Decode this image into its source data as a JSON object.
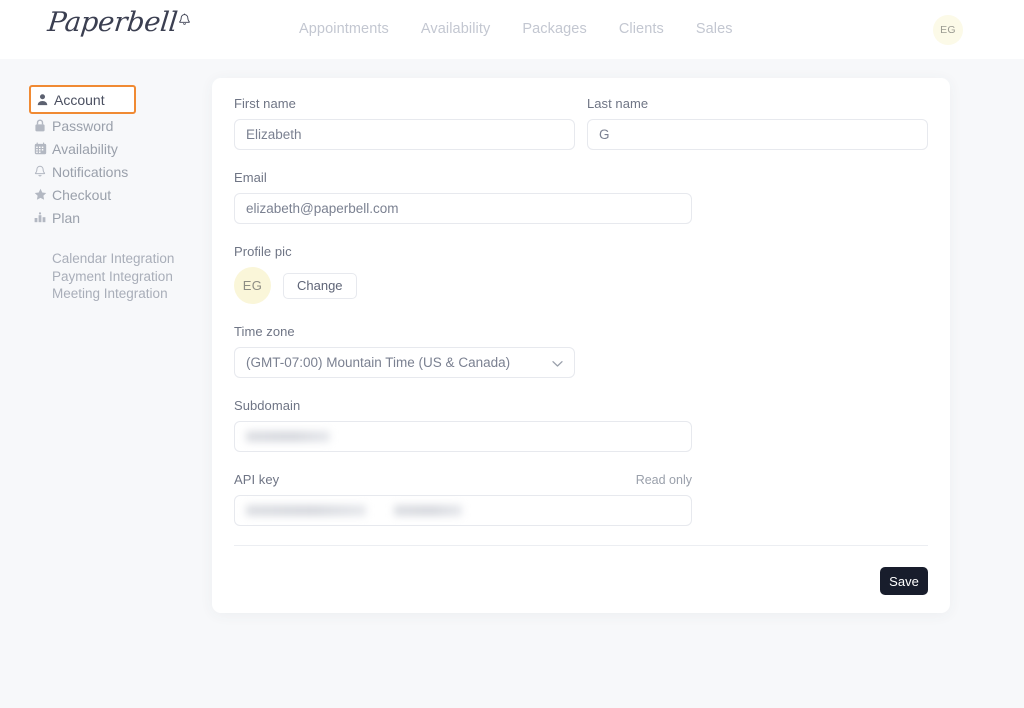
{
  "header": {
    "logo_text": "Paperbell",
    "logo_icon": "bell-icon",
    "nav": [
      {
        "label": "Appointments",
        "name": "nav-appointments"
      },
      {
        "label": "Availability",
        "name": "nav-availability"
      },
      {
        "label": "Packages",
        "name": "nav-packages"
      },
      {
        "label": "Clients",
        "name": "nav-clients"
      },
      {
        "label": "Sales",
        "name": "nav-sales"
      }
    ],
    "avatar_initials": "EG"
  },
  "sidebar": {
    "items": [
      {
        "label": "Account",
        "icon": "person-icon",
        "active": true
      },
      {
        "label": "Password",
        "icon": "lock-icon",
        "active": false
      },
      {
        "label": "Availability",
        "icon": "calendar-icon",
        "active": false
      },
      {
        "label": "Notifications",
        "icon": "bell-icon",
        "active": false
      },
      {
        "label": "Checkout",
        "icon": "star-icon",
        "active": false
      },
      {
        "label": "Plan",
        "icon": "bar-chart-icon",
        "active": false
      }
    ],
    "links": [
      {
        "label": "Calendar Integration"
      },
      {
        "label": "Payment Integration"
      },
      {
        "label": "Meeting Integration"
      }
    ],
    "highlight_color": "#f08a33"
  },
  "form": {
    "first_name": {
      "label": "First name",
      "value": "Elizabeth"
    },
    "last_name": {
      "label": "Last name",
      "value": "G"
    },
    "email": {
      "label": "Email",
      "value": "elizabeth@paperbell.com"
    },
    "profile_pic": {
      "label": "Profile pic",
      "avatar_initials": "EG",
      "change_label": "Change"
    },
    "time_zone": {
      "label": "Time zone",
      "value": "(GMT-07:00) Mountain Time (US & Canada)"
    },
    "subdomain": {
      "label": "Subdomain",
      "value": ""
    },
    "api_key": {
      "label": "API key",
      "readonly_label": "Read only",
      "value": ""
    },
    "save_label": "Save"
  }
}
